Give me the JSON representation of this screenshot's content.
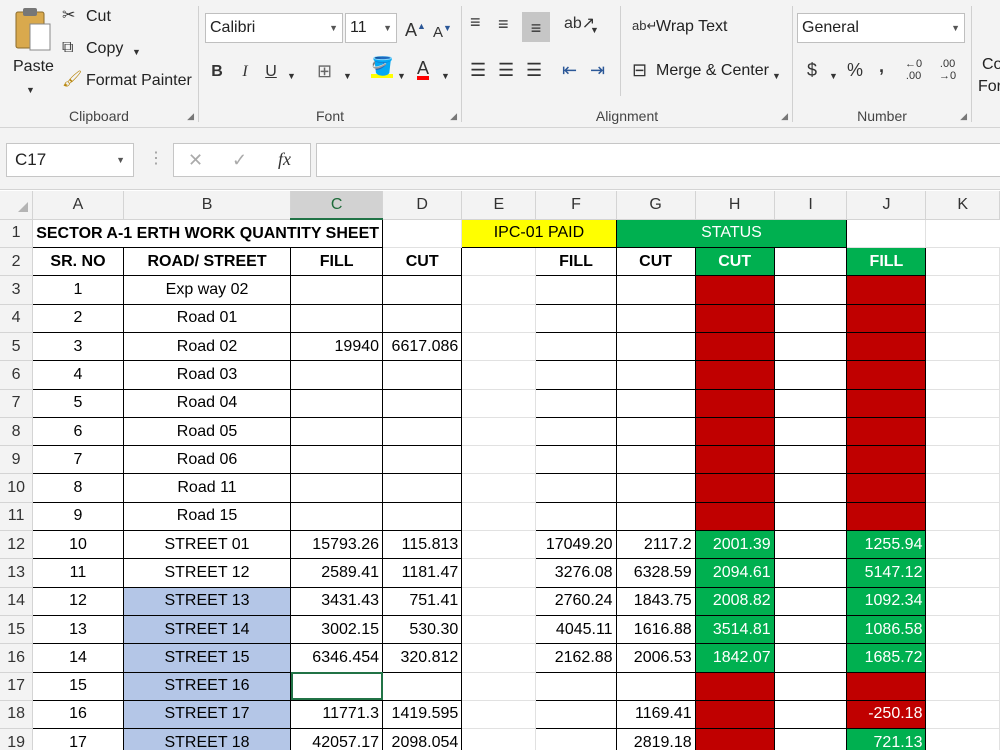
{
  "ribbon": {
    "clipboard": {
      "paste": "Paste",
      "cut": "Cut",
      "copy": "Copy",
      "format_painter": "Format Painter",
      "label": "Clipboard"
    },
    "font": {
      "name": "Calibri",
      "size": "11",
      "bold": "B",
      "italic": "I",
      "underline": "U",
      "label": "Font"
    },
    "alignment": {
      "wrap_text": "Wrap Text",
      "merge_center": "Merge & Center",
      "label": "Alignment"
    },
    "number": {
      "format": "General",
      "currency": "$",
      "percent": "%",
      "comma": ",",
      "label": "Number"
    },
    "styles": {
      "cond_format_1": "Co",
      "cond_format_2": "For"
    }
  },
  "formula_bar": {
    "name_box": "C17",
    "formula": ""
  },
  "columns": [
    "A",
    "B",
    "C",
    "D",
    "E",
    "F",
    "G",
    "H",
    "I",
    "J",
    "K"
  ],
  "selected_column": "C",
  "rows": [
    {
      "n": "1",
      "A": "SECTOR A-1 ERTH WORK QUANTITY SHEET",
      "F": "IPC-01 PAID",
      "H": "STATUS"
    },
    {
      "n": "2",
      "A": "SR. NO",
      "B": "ROAD/ STREET",
      "C": "FILL",
      "D": "CUT",
      "F": "FILL",
      "G": "CUT",
      "H": "CUT",
      "J": "FILL"
    },
    {
      "n": "3",
      "A": "1",
      "B": "Exp way 02",
      "C": "",
      "D": "",
      "F": "",
      "G": "",
      "H": "",
      "J": ""
    },
    {
      "n": "4",
      "A": "2",
      "B": "Road 01",
      "C": "",
      "D": "",
      "F": "",
      "G": "",
      "H": "",
      "J": ""
    },
    {
      "n": "5",
      "A": "3",
      "B": "Road 02",
      "C": "19940",
      "D": "6617.086",
      "F": "",
      "G": "",
      "H": "",
      "J": ""
    },
    {
      "n": "6",
      "A": "4",
      "B": "Road 03",
      "C": "",
      "D": "",
      "F": "",
      "G": "",
      "H": "",
      "J": ""
    },
    {
      "n": "7",
      "A": "5",
      "B": "Road 04",
      "C": "",
      "D": "",
      "F": "",
      "G": "",
      "H": "",
      "J": ""
    },
    {
      "n": "8",
      "A": "6",
      "B": "Road 05",
      "C": "",
      "D": "",
      "F": "",
      "G": "",
      "H": "",
      "J": ""
    },
    {
      "n": "9",
      "A": "7",
      "B": "Road 06",
      "C": "",
      "D": "",
      "F": "",
      "G": "",
      "H": "",
      "J": ""
    },
    {
      "n": "10",
      "A": "8",
      "B": "Road 11",
      "C": "",
      "D": "",
      "F": "",
      "G": "",
      "H": "",
      "J": ""
    },
    {
      "n": "11",
      "A": "9",
      "B": "Road 15",
      "C": "",
      "D": "",
      "F": "",
      "G": "",
      "H": "",
      "J": ""
    },
    {
      "n": "12",
      "A": "10",
      "B": "STREET 01",
      "C": "15793.26",
      "D": "115.813",
      "F": "17049.20",
      "G": "2117.2",
      "H": "2001.39",
      "J": "1255.94"
    },
    {
      "n": "13",
      "A": "11",
      "B": "STREET 12",
      "C": "2589.41",
      "D": "1181.47",
      "F": "3276.08",
      "G": "6328.59",
      "H": "2094.61",
      "J": "5147.12"
    },
    {
      "n": "14",
      "A": "12",
      "B": "STREET 13",
      "C": "3431.43",
      "D": "751.41",
      "F": "2760.24",
      "G": "1843.75",
      "H": "2008.82",
      "J": "1092.34"
    },
    {
      "n": "15",
      "A": "13",
      "B": "STREET 14",
      "C": "3002.15",
      "D": "530.30",
      "F": "4045.11",
      "G": "1616.88",
      "H": "3514.81",
      "J": "1086.58"
    },
    {
      "n": "16",
      "A": "14",
      "B": "STREET 15",
      "C": "6346.454",
      "D": "320.812",
      "F": "2162.88",
      "G": "2006.53",
      "H": "1842.07",
      "J": "1685.72"
    },
    {
      "n": "17",
      "A": "15",
      "B": "STREET 16",
      "C": "",
      "D": "",
      "F": "",
      "G": "",
      "H": "",
      "J": ""
    },
    {
      "n": "18",
      "A": "16",
      "B": "STREET 17",
      "C": "11771.3",
      "D": "1419.595",
      "F": "",
      "G": "1169.41",
      "H": "",
      "J": "-250.18"
    },
    {
      "n": "19",
      "A": "17",
      "B": "STREET 18",
      "C": "42057.17",
      "D": "2098.054",
      "F": "",
      "G": "2819.18",
      "H": "",
      "J": "721.13"
    }
  ],
  "colors": {
    "green": "#00b050",
    "red": "#c00000",
    "yellow": "#ffff00",
    "blue": "#b4c6e7",
    "excel_green": "#217346"
  }
}
